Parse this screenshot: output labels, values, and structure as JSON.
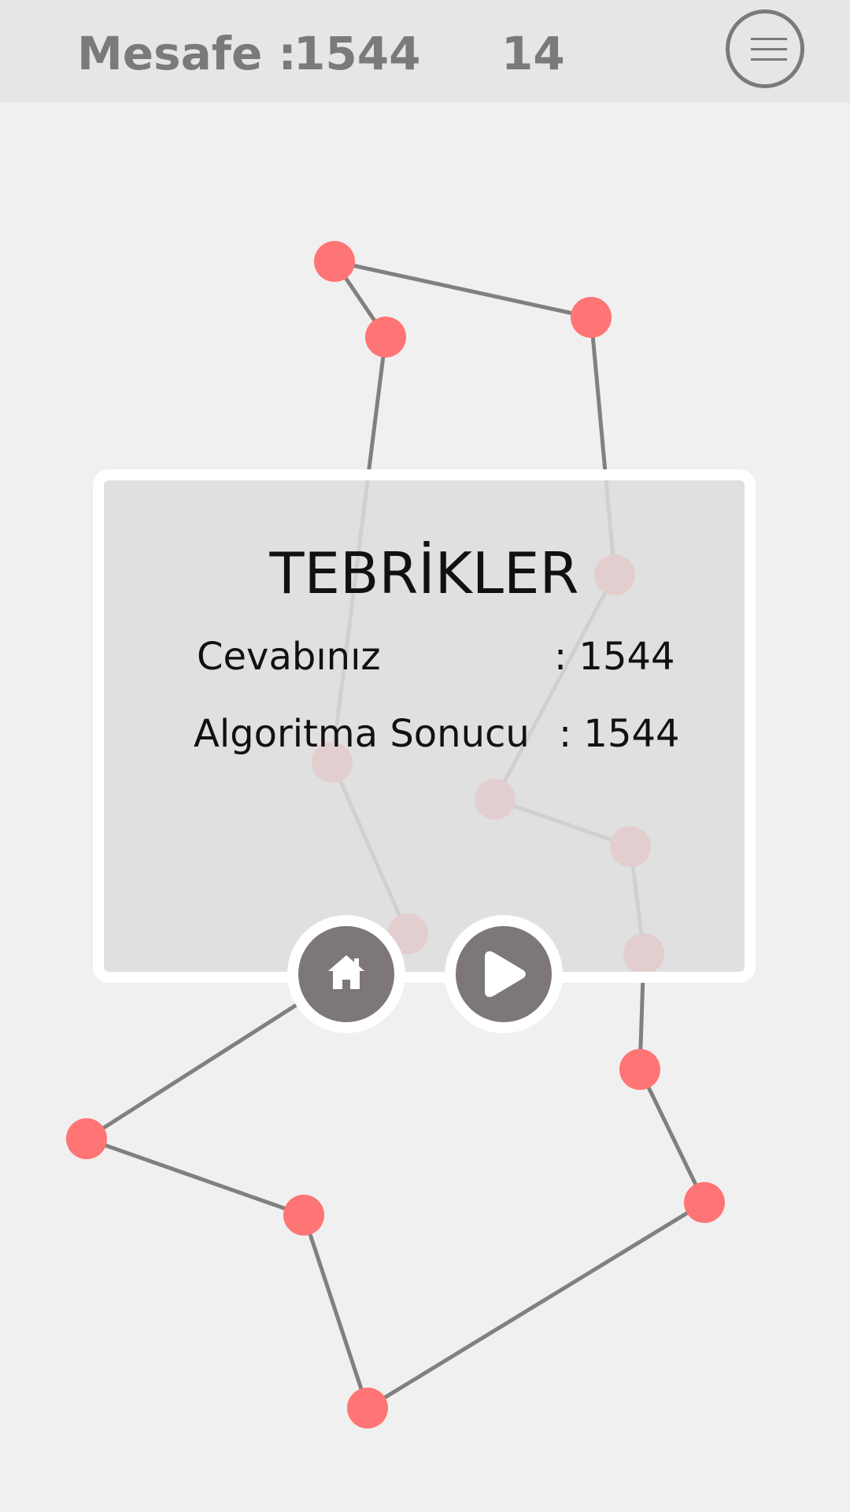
{
  "header": {
    "distance_label": "Mesafe :",
    "distance_value": "1544",
    "node_count": "14",
    "menu_icon": "hamburger-menu-icon"
  },
  "dialog": {
    "title": "TEBRİKLER",
    "answer_label": "Cevabınız",
    "answer_value": ": 1544",
    "algorithm_label": "Algoritma Sonucu",
    "algorithm_value": ": 1544",
    "home_icon": "home-icon",
    "play_icon": "play-icon"
  },
  "colors": {
    "node": "#ff7474",
    "edge": "#808080",
    "topbar": "#e6e6e6",
    "button": "#7d7777"
  }
}
